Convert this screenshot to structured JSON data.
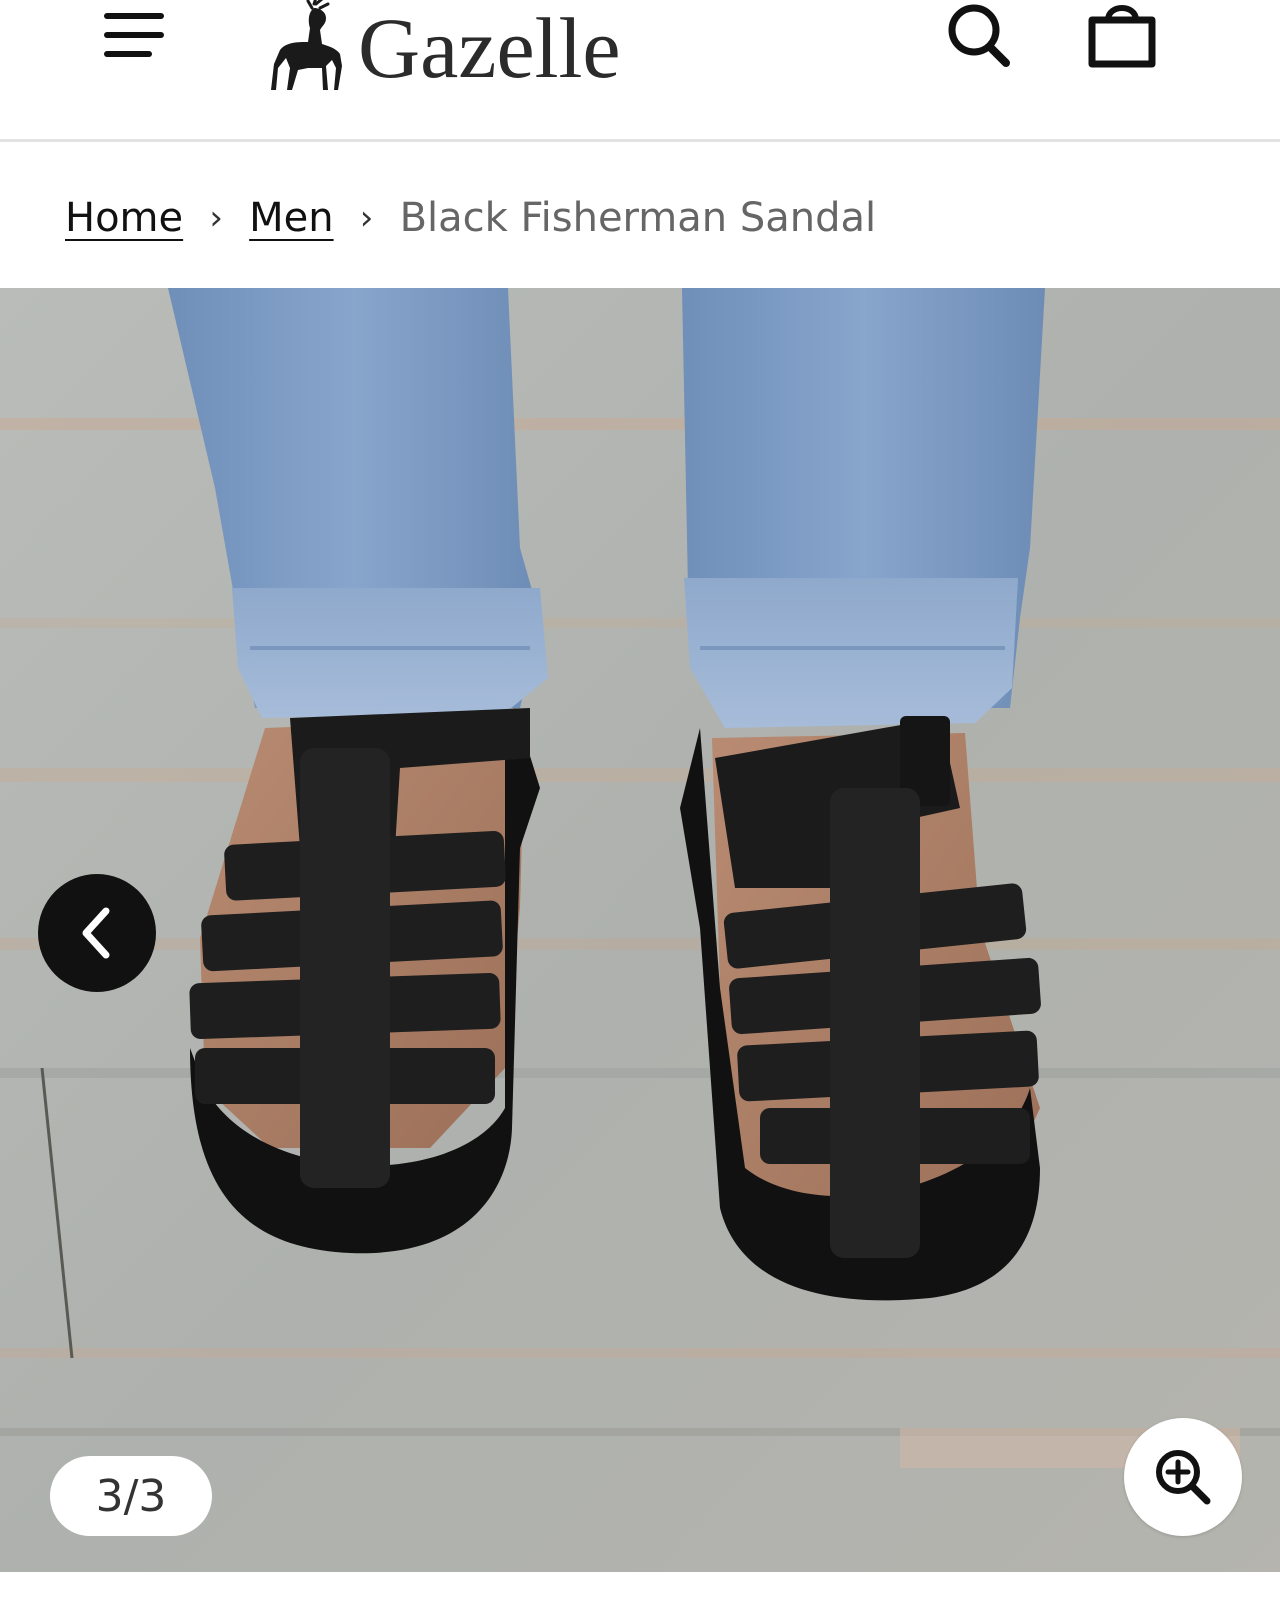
{
  "header": {
    "brand": "Gazelle",
    "menu_icon": "hamburger-menu-icon",
    "logo_icon": "deer-logo-icon",
    "search_icon": "search-icon",
    "bag_icon": "shopping-bag-icon"
  },
  "breadcrumb": {
    "items": [
      {
        "label": "Home"
      },
      {
        "label": "Men"
      }
    ],
    "separator": "›",
    "current": "Black Fisherman Sandal"
  },
  "gallery": {
    "counter": "3/3",
    "prev_icon": "chevron-left-icon",
    "zoom_icon": "zoom-in-icon"
  }
}
